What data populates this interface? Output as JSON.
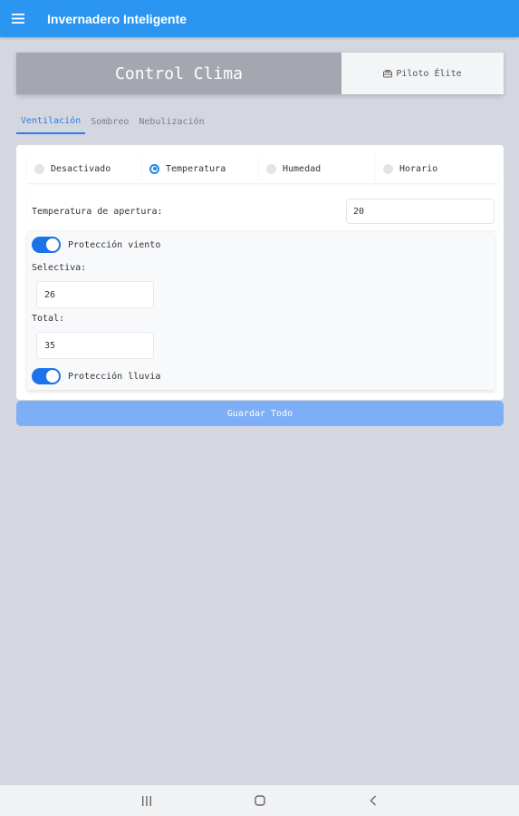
{
  "app": {
    "title": "Invernadero Inteligente"
  },
  "header": {
    "title": "Control Clima",
    "pilot_button": "Piloto Élite"
  },
  "tabs": [
    {
      "label": "Ventilación",
      "active": true
    },
    {
      "label": "Sombreo",
      "active": false
    },
    {
      "label": "Nebulización",
      "active": false
    }
  ],
  "mode": {
    "options": [
      "Desactivado",
      "Temperatura",
      "Humedad",
      "Horario"
    ],
    "selected": "Temperatura"
  },
  "temperature": {
    "label": "Temperatura de apertura:",
    "value": "20"
  },
  "wind": {
    "label": "Protección viento",
    "enabled": true,
    "selective_label": "Selectiva:",
    "selective_value": "26",
    "total_label": "Total:",
    "total_value": "35"
  },
  "rain": {
    "label": "Protección lluvia",
    "enabled": true
  },
  "save_button": "Guardar Todo",
  "colors": {
    "appbar": "#2b96f1",
    "accent": "#1a73e8",
    "header_title_bg": "#a4a7af",
    "save_button_bg": "#7eaef6",
    "background": "#d4d7e0"
  }
}
